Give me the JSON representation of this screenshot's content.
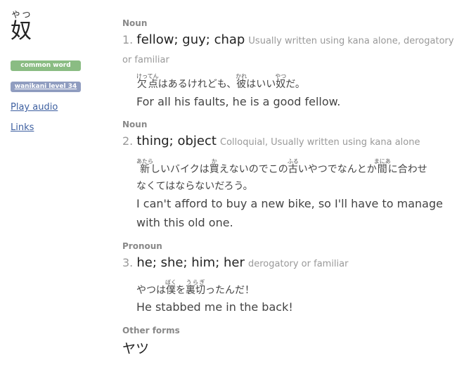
{
  "word": {
    "kanji": "奴",
    "reading": "やつ"
  },
  "tags": {
    "common": "common word",
    "wanikani": "wanikani level 34"
  },
  "links": {
    "play_audio": "Play audio",
    "links": "Links"
  },
  "senses": [
    {
      "pos": "Noun",
      "number": "1.",
      "meaning": "fellow; guy; chap",
      "info": "Usually written using kana alone, derogatory or familiar",
      "example_jp": [
        {
          "base": "欠点",
          "ruby": "けってん"
        },
        {
          "base": "はあるけれども、",
          "ruby": ""
        },
        {
          "base": "彼",
          "ruby": "かれ"
        },
        {
          "base": "はいい",
          "ruby": ""
        },
        {
          "base": "奴",
          "ruby": "やつ"
        },
        {
          "base": "だ。",
          "ruby": ""
        }
      ],
      "example_en": "For all his faults, he is a good fellow."
    },
    {
      "pos": "Noun",
      "number": "2.",
      "meaning": "thing; object",
      "info": "Colloquial, Usually written using kana alone",
      "example_jp": [
        {
          "base": "新",
          "ruby": "あたら"
        },
        {
          "base": "しいバイクは",
          "ruby": ""
        },
        {
          "base": "買",
          "ruby": "か"
        },
        {
          "base": "えないのでこの",
          "ruby": ""
        },
        {
          "base": "古",
          "ruby": "ふる"
        },
        {
          "base": "いやつでなんとか",
          "ruby": ""
        },
        {
          "base": "間",
          "ruby": "まにあ"
        },
        {
          "base": "に合わせなくてはならないだろう。",
          "ruby": ""
        }
      ],
      "example_en": "I can't afford to buy a new bike, so I'll have to manage with this old one."
    },
    {
      "pos": "Pronoun",
      "number": "3.",
      "meaning": "he; she; him; her",
      "info": "derogatory or familiar",
      "example_jp": [
        {
          "base": "やつは",
          "ruby": ""
        },
        {
          "base": "僕",
          "ruby": "ぼく"
        },
        {
          "base": "を",
          "ruby": ""
        },
        {
          "base": "裏切",
          "ruby": "うらぎ"
        },
        {
          "base": "ったんだ！",
          "ruby": ""
        }
      ],
      "example_en": "He stabbed me in the back!"
    }
  ],
  "other_forms": {
    "label": "Other forms",
    "value": "ヤツ"
  }
}
